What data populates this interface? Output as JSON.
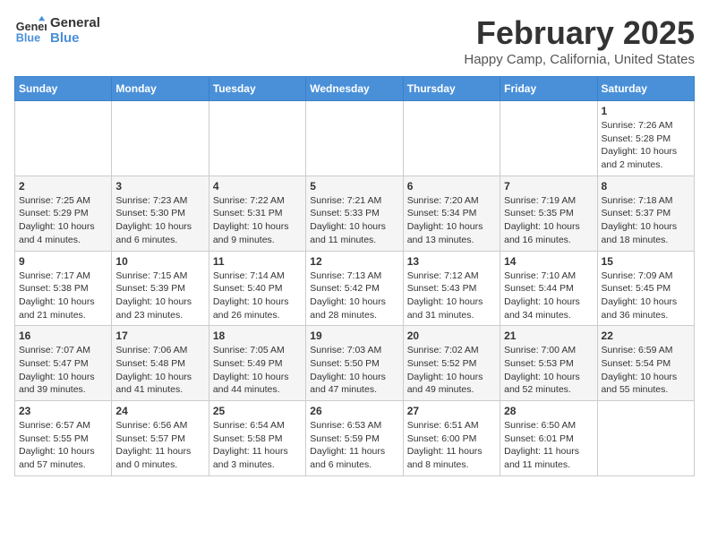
{
  "logo": {
    "text_general": "General",
    "text_blue": "Blue"
  },
  "title": "February 2025",
  "location": "Happy Camp, California, United States",
  "days_of_week": [
    "Sunday",
    "Monday",
    "Tuesday",
    "Wednesday",
    "Thursday",
    "Friday",
    "Saturday"
  ],
  "weeks": [
    [
      {
        "day": "",
        "info": ""
      },
      {
        "day": "",
        "info": ""
      },
      {
        "day": "",
        "info": ""
      },
      {
        "day": "",
        "info": ""
      },
      {
        "day": "",
        "info": ""
      },
      {
        "day": "",
        "info": ""
      },
      {
        "day": "1",
        "info": "Sunrise: 7:26 AM\nSunset: 5:28 PM\nDaylight: 10 hours\nand 2 minutes."
      }
    ],
    [
      {
        "day": "2",
        "info": "Sunrise: 7:25 AM\nSunset: 5:29 PM\nDaylight: 10 hours\nand 4 minutes."
      },
      {
        "day": "3",
        "info": "Sunrise: 7:23 AM\nSunset: 5:30 PM\nDaylight: 10 hours\nand 6 minutes."
      },
      {
        "day": "4",
        "info": "Sunrise: 7:22 AM\nSunset: 5:31 PM\nDaylight: 10 hours\nand 9 minutes."
      },
      {
        "day": "5",
        "info": "Sunrise: 7:21 AM\nSunset: 5:33 PM\nDaylight: 10 hours\nand 11 minutes."
      },
      {
        "day": "6",
        "info": "Sunrise: 7:20 AM\nSunset: 5:34 PM\nDaylight: 10 hours\nand 13 minutes."
      },
      {
        "day": "7",
        "info": "Sunrise: 7:19 AM\nSunset: 5:35 PM\nDaylight: 10 hours\nand 16 minutes."
      },
      {
        "day": "8",
        "info": "Sunrise: 7:18 AM\nSunset: 5:37 PM\nDaylight: 10 hours\nand 18 minutes."
      }
    ],
    [
      {
        "day": "9",
        "info": "Sunrise: 7:17 AM\nSunset: 5:38 PM\nDaylight: 10 hours\nand 21 minutes."
      },
      {
        "day": "10",
        "info": "Sunrise: 7:15 AM\nSunset: 5:39 PM\nDaylight: 10 hours\nand 23 minutes."
      },
      {
        "day": "11",
        "info": "Sunrise: 7:14 AM\nSunset: 5:40 PM\nDaylight: 10 hours\nand 26 minutes."
      },
      {
        "day": "12",
        "info": "Sunrise: 7:13 AM\nSunset: 5:42 PM\nDaylight: 10 hours\nand 28 minutes."
      },
      {
        "day": "13",
        "info": "Sunrise: 7:12 AM\nSunset: 5:43 PM\nDaylight: 10 hours\nand 31 minutes."
      },
      {
        "day": "14",
        "info": "Sunrise: 7:10 AM\nSunset: 5:44 PM\nDaylight: 10 hours\nand 34 minutes."
      },
      {
        "day": "15",
        "info": "Sunrise: 7:09 AM\nSunset: 5:45 PM\nDaylight: 10 hours\nand 36 minutes."
      }
    ],
    [
      {
        "day": "16",
        "info": "Sunrise: 7:07 AM\nSunset: 5:47 PM\nDaylight: 10 hours\nand 39 minutes."
      },
      {
        "day": "17",
        "info": "Sunrise: 7:06 AM\nSunset: 5:48 PM\nDaylight: 10 hours\nand 41 minutes."
      },
      {
        "day": "18",
        "info": "Sunrise: 7:05 AM\nSunset: 5:49 PM\nDaylight: 10 hours\nand 44 minutes."
      },
      {
        "day": "19",
        "info": "Sunrise: 7:03 AM\nSunset: 5:50 PM\nDaylight: 10 hours\nand 47 minutes."
      },
      {
        "day": "20",
        "info": "Sunrise: 7:02 AM\nSunset: 5:52 PM\nDaylight: 10 hours\nand 49 minutes."
      },
      {
        "day": "21",
        "info": "Sunrise: 7:00 AM\nSunset: 5:53 PM\nDaylight: 10 hours\nand 52 minutes."
      },
      {
        "day": "22",
        "info": "Sunrise: 6:59 AM\nSunset: 5:54 PM\nDaylight: 10 hours\nand 55 minutes."
      }
    ],
    [
      {
        "day": "23",
        "info": "Sunrise: 6:57 AM\nSunset: 5:55 PM\nDaylight: 10 hours\nand 57 minutes."
      },
      {
        "day": "24",
        "info": "Sunrise: 6:56 AM\nSunset: 5:57 PM\nDaylight: 11 hours\nand 0 minutes."
      },
      {
        "day": "25",
        "info": "Sunrise: 6:54 AM\nSunset: 5:58 PM\nDaylight: 11 hours\nand 3 minutes."
      },
      {
        "day": "26",
        "info": "Sunrise: 6:53 AM\nSunset: 5:59 PM\nDaylight: 11 hours\nand 6 minutes."
      },
      {
        "day": "27",
        "info": "Sunrise: 6:51 AM\nSunset: 6:00 PM\nDaylight: 11 hours\nand 8 minutes."
      },
      {
        "day": "28",
        "info": "Sunrise: 6:50 AM\nSunset: 6:01 PM\nDaylight: 11 hours\nand 11 minutes."
      },
      {
        "day": "",
        "info": ""
      }
    ]
  ]
}
